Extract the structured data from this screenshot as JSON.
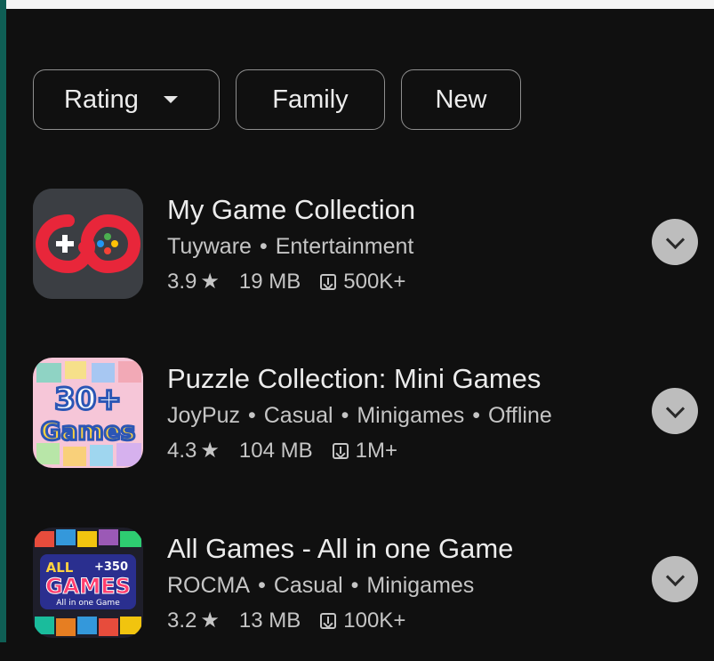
{
  "filters": [
    {
      "label": "Rating",
      "has_dropdown": true
    },
    {
      "label": "Family"
    },
    {
      "label": "New"
    }
  ],
  "apps": [
    {
      "title": "My Game Collection",
      "developer": "Tuyware",
      "tags": [
        "Entertainment"
      ],
      "rating": "3.9",
      "size": "19 MB",
      "downloads": "500K+",
      "icon": "controller-infinity-icon"
    },
    {
      "title": "Puzzle Collection: Mini Games",
      "developer": "JoyPuz",
      "tags": [
        "Casual",
        "Minigames",
        "Offline"
      ],
      "rating": "4.3",
      "size": "104 MB",
      "downloads": "1M+",
      "icon": "30-games-icon",
      "icon_text": [
        "30+",
        "Games"
      ]
    },
    {
      "title": "All Games - All in one Game",
      "developer": "ROCMA",
      "tags": [
        "Casual",
        "Minigames"
      ],
      "rating": "3.2",
      "size": "13 MB",
      "downloads": "100K+",
      "icon": "all-games-icon",
      "icon_text": [
        "ALL",
        "+350",
        "GAMES",
        "All in one Game"
      ]
    }
  ],
  "labels": {
    "star": "★",
    "bullet": "•"
  },
  "colors": {
    "background": "#101010",
    "chip_border": "#8e8e8e",
    "expand_button": "#bdbdbd",
    "icon1_red": "#e8263a"
  }
}
